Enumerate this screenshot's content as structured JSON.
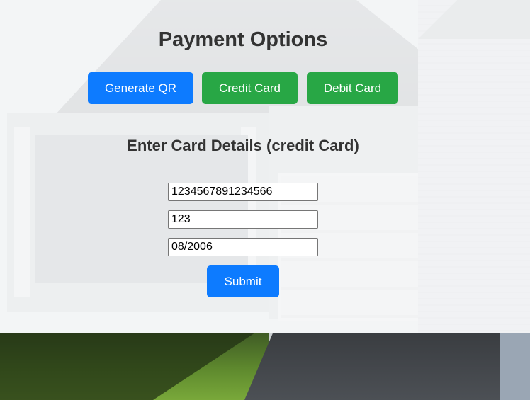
{
  "page": {
    "title": "Payment Options"
  },
  "payment_methods": [
    {
      "label": "Generate QR",
      "color": "#0d7bff"
    },
    {
      "label": "Credit Card",
      "color": "#28a745"
    },
    {
      "label": "Debit Card",
      "color": "#28a745"
    }
  ],
  "card_form": {
    "heading": "Enter Card Details (credit Card)",
    "card_number": {
      "value": "1234567891234566"
    },
    "cvv": {
      "value": "123"
    },
    "expiry": {
      "value": "08/2006"
    },
    "submit_label": "Submit",
    "submit_color": "#0d7bff"
  },
  "background": {
    "description_icon": "house-photo"
  }
}
